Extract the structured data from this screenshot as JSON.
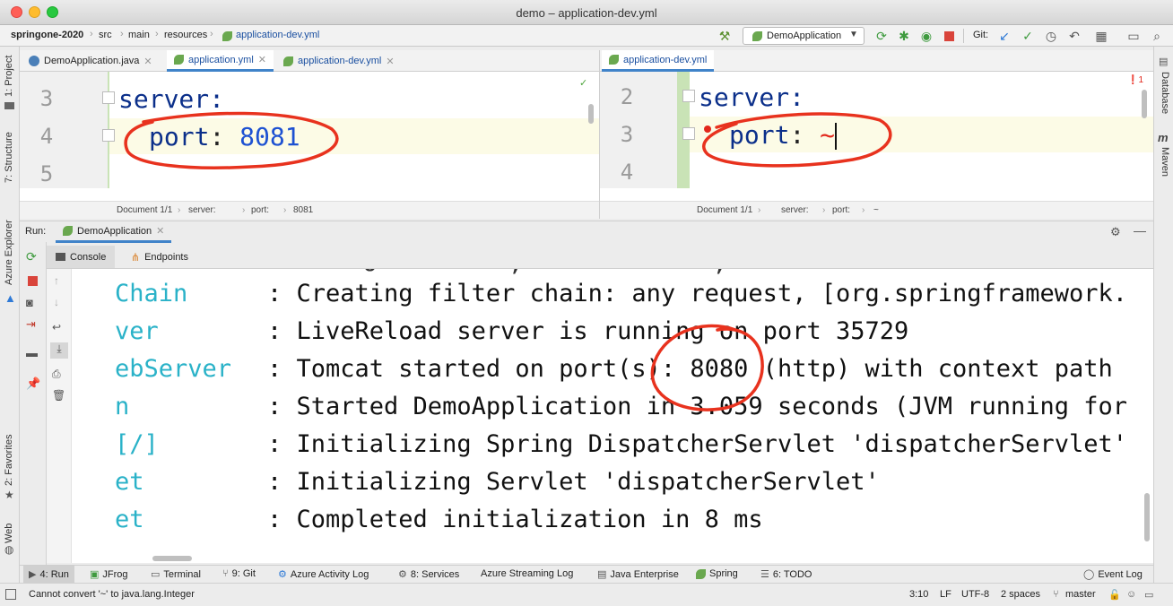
{
  "window": {
    "title": "demo – application-dev.yml"
  },
  "navbar": {
    "breadcrumbs": [
      "springone-2020",
      "src",
      "main",
      "resources",
      "application-dev.yml"
    ],
    "run_config": "DemoApplication",
    "git_label": "Git:"
  },
  "side": {
    "left_top": [
      "1: Project",
      "7: Structure",
      "Azure Explorer"
    ],
    "left_bottom": [
      "2: Favorites",
      "Web"
    ],
    "right": [
      "Database",
      "Maven"
    ]
  },
  "left_editor": {
    "tabs": [
      "DemoApplication.java",
      "application.yml",
      "application-dev.yml"
    ],
    "lines": [
      {
        "num": "3",
        "text": "server:"
      },
      {
        "num": "4",
        "key": "port",
        "value": "8081"
      },
      {
        "num": "5",
        "text": ""
      }
    ],
    "breadcrumb": [
      "Document 1/1",
      "server:",
      "port:",
      "8081"
    ]
  },
  "right_editor": {
    "tab": "application-dev.yml",
    "lines": [
      {
        "num": "2",
        "text": "server:"
      },
      {
        "num": "3",
        "key": "port",
        "value": "~"
      },
      {
        "num": "4",
        "text": ""
      }
    ],
    "breadcrumb": [
      "Document 1/1",
      "server:",
      "port:",
      "~"
    ],
    "error_count": "1"
  },
  "run": {
    "label": "Run:",
    "config": "DemoApplication",
    "tabs": [
      "Console",
      "Endpoints"
    ]
  },
  "console": {
    "lines": [
      {
        "name": "Chain",
        "msg": ": Creating filter chain: any request, [org.springframework."
      },
      {
        "name": "ver",
        "msg": ": LiveReload server is running on port 35729"
      },
      {
        "name": "ebServer",
        "msg": ": Tomcat started on port(s): 8080 (http) with context path"
      },
      {
        "name": "n",
        "msg": ": Started DemoApplication in 3.059 seconds (JVM running for"
      },
      {
        "name": "[/]",
        "msg": ": Initializing Spring DispatcherServlet 'dispatcherServlet'"
      },
      {
        "name": "et",
        "msg": ": Initializing Servlet 'dispatcherServlet'"
      },
      {
        "name": "et",
        "msg": ": Completed initialization in 8 ms"
      }
    ]
  },
  "bottom_tabs": [
    "4: Run",
    "JFrog",
    "Terminal",
    "9: Git",
    "Azure Activity Log",
    "8: Services",
    "Azure Streaming Log",
    "Java Enterprise",
    "Spring",
    "6: TODO"
  ],
  "event_log": "Event Log",
  "status": {
    "message": "Cannot convert '~' to java.lang.Integer",
    "position": "3:10",
    "line_sep": "LF",
    "encoding": "UTF-8",
    "indent": "2 spaces",
    "branch": "master"
  },
  "colors": {
    "annotation": "#e8321e",
    "accent": "#4083c9",
    "console_name": "#2ab2c8"
  }
}
